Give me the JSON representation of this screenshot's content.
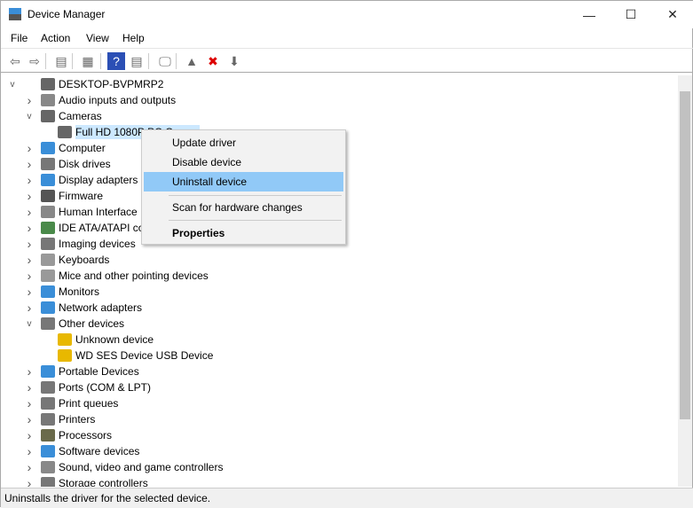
{
  "window": {
    "title": "Device Manager",
    "minimize": "—",
    "maximize": "☐",
    "close": "✕"
  },
  "menubar": [
    "File",
    "Action",
    "View",
    "Help"
  ],
  "toolbar": [
    {
      "name": "back-icon",
      "glyph": "⇦"
    },
    {
      "name": "forward-icon",
      "glyph": "⇨"
    },
    {
      "name": "show-hide-console-tree-icon",
      "glyph": "▤"
    },
    {
      "name": "properties-icon",
      "glyph": "▦"
    },
    {
      "name": "help-icon",
      "glyph": "?"
    },
    {
      "name": "action-pane-icon",
      "glyph": "▤"
    },
    {
      "name": "scan-hardware-icon",
      "glyph": "🖵"
    },
    {
      "name": "update-driver-icon",
      "glyph": "▲"
    },
    {
      "name": "uninstall-icon",
      "glyph": "✖"
    },
    {
      "name": "disable-icon",
      "glyph": "⬇"
    }
  ],
  "tree": {
    "root": "DESKTOP-BVPMRP2",
    "items": [
      {
        "label": "Audio inputs and outputs",
        "level": 1,
        "exp": ">",
        "color": "#888"
      },
      {
        "label": "Cameras",
        "level": 1,
        "exp": "v",
        "color": "#666"
      },
      {
        "label": "Full HD 1080P PC C",
        "level": 2,
        "exp": "",
        "color": "#666",
        "selected": true
      },
      {
        "label": "Computer",
        "level": 1,
        "exp": ">",
        "color": "#3a8ed8"
      },
      {
        "label": "Disk drives",
        "level": 1,
        "exp": ">",
        "color": "#777"
      },
      {
        "label": "Display adapters",
        "level": 1,
        "exp": ">",
        "color": "#3a8ed8"
      },
      {
        "label": "Firmware",
        "level": 1,
        "exp": ">",
        "color": "#555"
      },
      {
        "label": "Human Interface",
        "level": 1,
        "exp": ">",
        "color": "#888"
      },
      {
        "label": "IDE ATA/ATAPI co",
        "level": 1,
        "exp": ">",
        "color": "#4a8a4a"
      },
      {
        "label": "Imaging devices",
        "level": 1,
        "exp": ">",
        "color": "#777"
      },
      {
        "label": "Keyboards",
        "level": 1,
        "exp": ">",
        "color": "#999"
      },
      {
        "label": "Mice and other pointing devices",
        "level": 1,
        "exp": ">",
        "color": "#999"
      },
      {
        "label": "Monitors",
        "level": 1,
        "exp": ">",
        "color": "#3a8ed8"
      },
      {
        "label": "Network adapters",
        "level": 1,
        "exp": ">",
        "color": "#3a8ed8"
      },
      {
        "label": "Other devices",
        "level": 1,
        "exp": "v",
        "color": "#777"
      },
      {
        "label": "Unknown device",
        "level": 2,
        "exp": "",
        "color": "#e8b800"
      },
      {
        "label": "WD SES Device USB Device",
        "level": 2,
        "exp": "",
        "color": "#e8b800"
      },
      {
        "label": "Portable Devices",
        "level": 1,
        "exp": ">",
        "color": "#3a8ed8"
      },
      {
        "label": "Ports (COM & LPT)",
        "level": 1,
        "exp": ">",
        "color": "#777"
      },
      {
        "label": "Print queues",
        "level": 1,
        "exp": ">",
        "color": "#777"
      },
      {
        "label": "Printers",
        "level": 1,
        "exp": ">",
        "color": "#777"
      },
      {
        "label": "Processors",
        "level": 1,
        "exp": ">",
        "color": "#6a6a4a"
      },
      {
        "label": "Software devices",
        "level": 1,
        "exp": ">",
        "color": "#3a8ed8"
      },
      {
        "label": "Sound, video and game controllers",
        "level": 1,
        "exp": ">",
        "color": "#888"
      },
      {
        "label": "Storage controllers",
        "level": 1,
        "exp": ">",
        "color": "#777"
      }
    ]
  },
  "context_menu": {
    "items": [
      "Update driver",
      "Disable device",
      "Uninstall device",
      "Scan for hardware changes",
      "Properties"
    ],
    "highlighted": "Uninstall device",
    "highlight_color": "#91c9f7"
  },
  "status": "Uninstalls the driver for the selected device."
}
